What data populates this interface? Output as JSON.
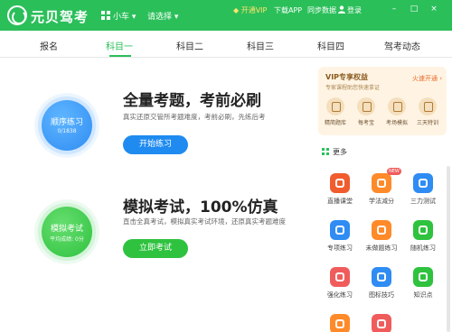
{
  "app": {
    "title": "元贝驾考"
  },
  "topbar": {
    "car_type": "小车 ▾",
    "region": "请选择 ▾",
    "vip": "开通VIP",
    "download": "下载APP",
    "sync": "同步数据",
    "login": "登录",
    "minimize": "–",
    "maximize": "□",
    "close": "×"
  },
  "tabs": [
    "报名",
    "科目一",
    "科目二",
    "科目三",
    "科目四",
    "驾考动态"
  ],
  "practice": {
    "circle_title": "顺序练习",
    "circle_sub": "0/1838",
    "title": "全量考题，考前必刷",
    "desc": "真实还原交管所考题难度，考前必刷，先练后考",
    "button": "开始练习"
  },
  "exam": {
    "circle_title": "模拟考试",
    "circle_sub": "平均成绩: 0分",
    "title": "模拟考试，100%仿真",
    "desc": "直击全真考试，模拟真实考试环境，还原真实考题难度",
    "button": "立即考试"
  },
  "vip_card": {
    "title": "VIP专享权益",
    "subtitle": "专家课程助您快速拿证",
    "renew": "火速开通 ›",
    "items": [
      "精简题库",
      "每考宝",
      "考场模拟",
      "三天特训"
    ]
  },
  "more": {
    "label": "更多"
  },
  "features": [
    {
      "label": "直播课堂",
      "color": "#f05c2d",
      "badge": ""
    },
    {
      "label": "学法减分",
      "color": "#ff8a2a",
      "badge": "NEW"
    },
    {
      "label": "三力测试",
      "color": "#2f8cf3",
      "badge": ""
    },
    {
      "label": "专项练习",
      "color": "#2f8cf3",
      "badge": ""
    },
    {
      "label": "未做题练习",
      "color": "#ff8a2a",
      "badge": ""
    },
    {
      "label": "随机练习",
      "color": "#2fc23f",
      "badge": ""
    },
    {
      "label": "强化练习",
      "color": "#f05c5c",
      "badge": ""
    },
    {
      "label": "图标技巧",
      "color": "#2f8cf3",
      "badge": ""
    },
    {
      "label": "知识点",
      "color": "#2fc23f",
      "badge": ""
    },
    {
      "label": "",
      "color": "#ff8a2a",
      "badge": ""
    },
    {
      "label": "",
      "color": "#f05c5c",
      "badge": ""
    }
  ]
}
